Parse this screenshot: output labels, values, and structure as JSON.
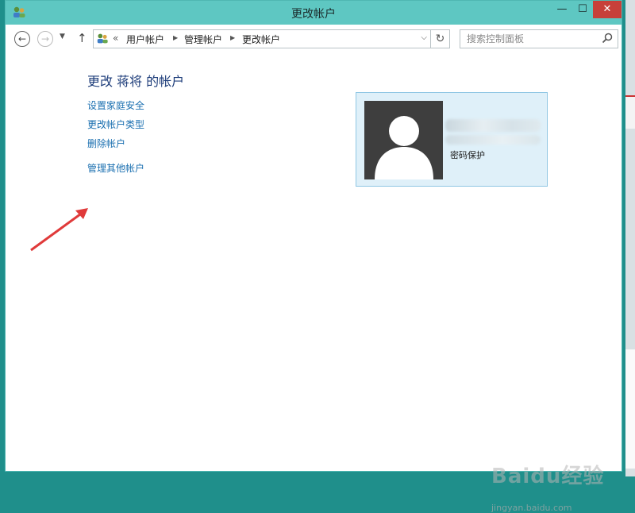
{
  "window": {
    "title": "更改帐户",
    "minimize_glyph": "—",
    "maximize_glyph": "☐",
    "close_glyph": "✕"
  },
  "nav": {
    "back_glyph": "←",
    "forward_glyph": "→",
    "recent_glyph": "▼",
    "up_glyph": "↑",
    "overflow_glyph": "«",
    "breadcrumb": [
      "用户帐户",
      "管理帐户",
      "更改帐户"
    ],
    "separator_glyph": "▶",
    "dropdown_glyph": "⌵",
    "refresh_glyph": "↻",
    "search_placeholder": "搜索控制面板"
  },
  "main": {
    "heading": "更改 蒋将 的帐户",
    "tasks": [
      "设置家庭安全",
      "更改帐户类型",
      "删除帐户",
      "管理其他帐户"
    ]
  },
  "account_card": {
    "status": "密码保护"
  },
  "watermark": {
    "brand": "Baidu经验",
    "url": "jingyan.baidu.com"
  },
  "colors": {
    "titlebar": "#5ec7c2",
    "link": "#1a6fb0",
    "heading": "#1e3d7a",
    "card_bg": "#dff0f9",
    "arrow": "#e03a3a"
  },
  "icons": {
    "title": "user-accounts-icon",
    "address": "user-accounts-icon",
    "search": "search-icon",
    "avatar": "user-avatar-icon",
    "annotation": "red-arrow-icon"
  }
}
